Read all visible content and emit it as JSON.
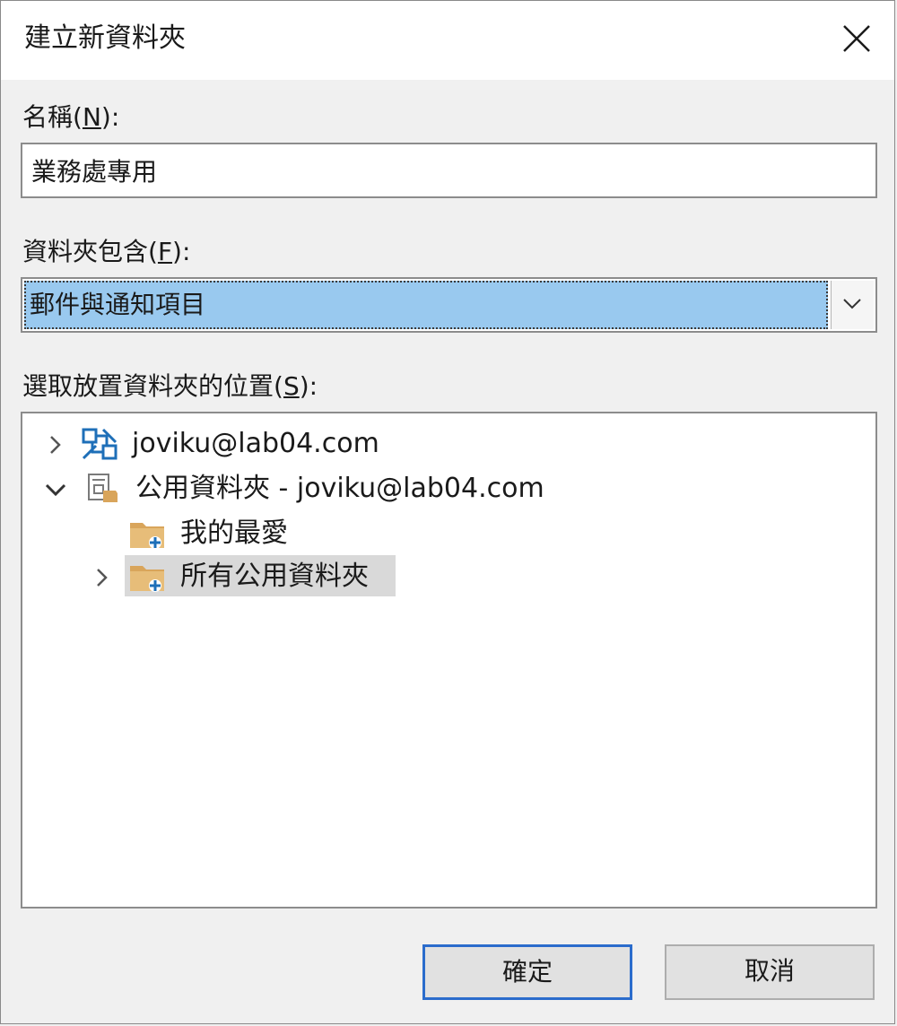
{
  "window": {
    "title": "建立新資料夾"
  },
  "name_field": {
    "label_prefix": "名稱(",
    "label_key": "N",
    "label_suffix": "):",
    "value": "業務處專用"
  },
  "folder_contains": {
    "label_prefix": "資料夾包含(",
    "label_key": "F",
    "label_suffix": "):",
    "selected": "郵件與通知項目"
  },
  "location": {
    "label_prefix": "選取放置資料夾的位置(",
    "label_key": "S",
    "label_suffix": "):",
    "tree": [
      {
        "label": "joviku@lab04.com",
        "icon": "exchange-account-icon",
        "expanded": false
      },
      {
        "label": "公用資料夾 - joviku@lab04.com",
        "icon": "public-folders-root-icon",
        "expanded": true
      },
      {
        "label": "我的最愛",
        "icon": "public-folder-icon"
      },
      {
        "label": "所有公用資料夾",
        "icon": "public-folder-icon",
        "expanded": false,
        "selected": true
      }
    ]
  },
  "buttons": {
    "ok": "確定",
    "cancel": "取消"
  },
  "colors": {
    "selection_highlight": "#99c9ef",
    "tree_selected": "#d9d9d9",
    "default_button_border": "#2b6ccc",
    "exchange_blue": "#1e6fb8",
    "folder_tan": "#d9a55b"
  }
}
